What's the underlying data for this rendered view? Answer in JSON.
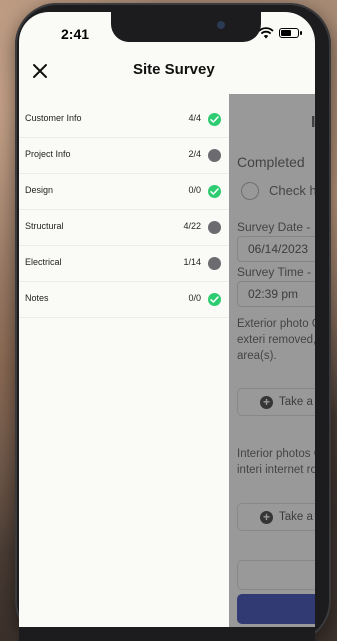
{
  "status_bar": {
    "time": "2:41"
  },
  "header": {
    "title": "Site Survey"
  },
  "drawer": {
    "items": [
      {
        "label": "Customer Info",
        "count": "4/4",
        "complete": true
      },
      {
        "label": "Project Info",
        "count": "2/4",
        "complete": false
      },
      {
        "label": "Design",
        "count": "0/0",
        "complete": true
      },
      {
        "label": "Structural",
        "count": "4/22",
        "complete": false
      },
      {
        "label": "Electrical",
        "count": "1/14",
        "complete": false
      },
      {
        "label": "Notes",
        "count": "0/0",
        "complete": true
      }
    ]
  },
  "main": {
    "completed_label": "Completed",
    "check_label": "Check h",
    "survey_date_label": "Survey Date -",
    "survey_date_value": "06/14/2023",
    "survey_time_label": "Survey Time -",
    "survey_time_value": "02:39 pm",
    "exterior_text": "Exterior photo General exteri removed, bac area(s).",
    "exterior_button": "Take a",
    "interior_text": "Interior photos General interi internet router",
    "interior_button": "Take a"
  },
  "colors": {
    "complete": "#2ecc71",
    "incomplete": "#6b6b70",
    "primary_button": "#0a1ea8"
  }
}
